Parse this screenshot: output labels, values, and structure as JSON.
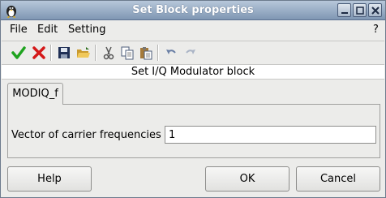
{
  "window": {
    "title": "Set Block properties"
  },
  "menubar": {
    "items": [
      {
        "label": "File"
      },
      {
        "label": "Edit"
      },
      {
        "label": "Setting"
      }
    ],
    "help_label": "?"
  },
  "toolbar": {
    "icons": [
      "ok-check-icon",
      "cancel-x-icon",
      "save-icon",
      "open-folder-icon",
      "cut-icon",
      "copy-icon",
      "paste-icon",
      "undo-icon",
      "redo-icon"
    ]
  },
  "block": {
    "header": "Set I/Q Modulator block"
  },
  "tabs": [
    {
      "label": "MODIQ_f"
    }
  ],
  "params": [
    {
      "label": "Vector of carrier frequencies",
      "value": "1"
    }
  ],
  "buttons": {
    "help": "Help",
    "ok": "OK",
    "cancel": "Cancel"
  },
  "colors": {
    "titlebar": "#8fa5bf",
    "ok_green": "#1fa31f",
    "cancel_red": "#d41818"
  }
}
